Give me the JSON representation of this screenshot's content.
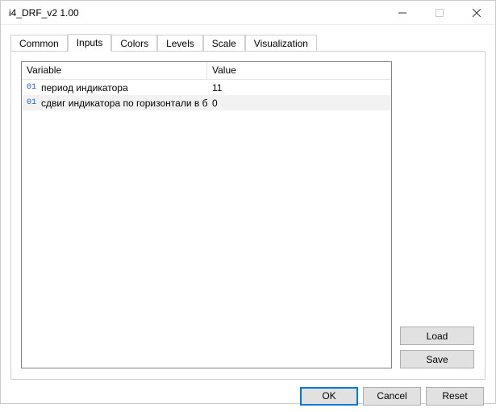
{
  "window": {
    "title": "i4_DRF_v2 1.00"
  },
  "tabs": [
    {
      "label": "Common",
      "active": false
    },
    {
      "label": "Inputs",
      "active": true
    },
    {
      "label": "Colors",
      "active": false
    },
    {
      "label": "Levels",
      "active": false
    },
    {
      "label": "Scale",
      "active": false
    },
    {
      "label": "Visualization",
      "active": false
    }
  ],
  "table": {
    "headers": {
      "variable": "Variable",
      "value": "Value"
    },
    "rows": [
      {
        "type_badge": "01",
        "name": "период индикатора",
        "value": "11",
        "selected": false
      },
      {
        "type_badge": "01",
        "name": "сдвиг индикатора по горизонтали в б...",
        "value": "0",
        "selected": true
      }
    ]
  },
  "side": {
    "load": "Load",
    "save": "Save"
  },
  "footer": {
    "ok": "OK",
    "cancel": "Cancel",
    "reset": "Reset"
  }
}
